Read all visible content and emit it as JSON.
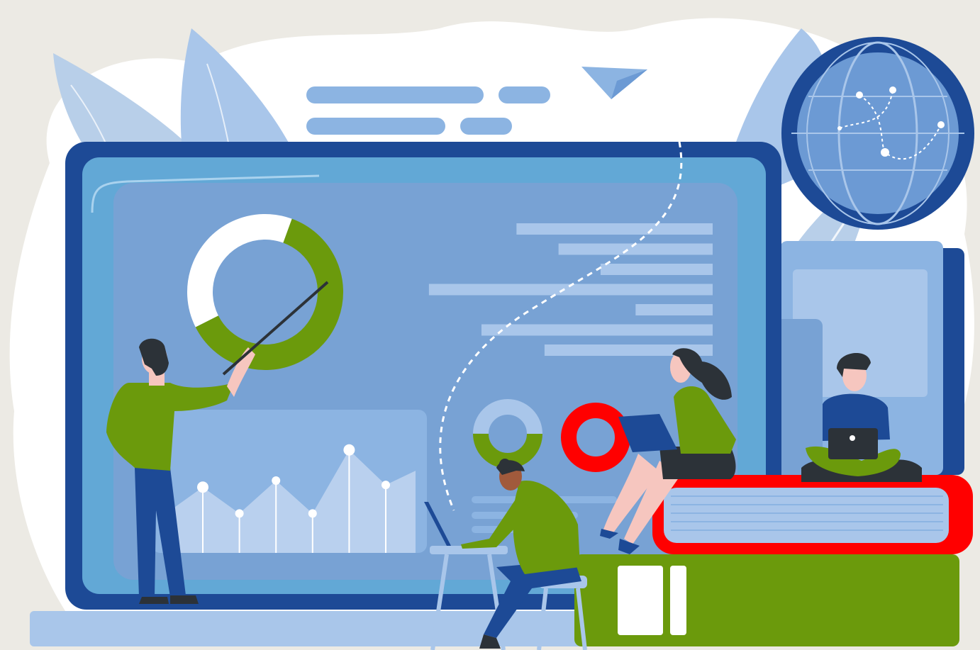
{
  "illustration": {
    "colors": {
      "background": "#eceae4",
      "blob": "#ffffff",
      "leaf": "#a9c6ea",
      "leaf_dark": "#8cb4e2",
      "monitor_frame": "#1d4a96",
      "monitor_screen": "#62a8d6",
      "panel": "#78a2d4",
      "bar_light": "#a9c6ea",
      "bar_dark": "#78a2d4",
      "accent_green": "#6b9a0c",
      "accent_red": "#ff0000",
      "skin": "#f6c6bf",
      "hair": "#2c3238",
      "navy": "#1d4a96",
      "white": "#ffffff"
    },
    "donut_chart": {
      "segments": [
        0.62,
        0.38
      ]
    },
    "red_ring": {
      "segments": [
        1.0
      ]
    },
    "small_ring": {
      "segments": [
        0.5,
        0.5
      ]
    },
    "line_chart": {
      "values": [
        3,
        1.8,
        3.3,
        1.8,
        4.7,
        3.1
      ]
    },
    "horizontal_bars": {
      "split": [
        0.44,
        0.56,
        0.68,
        0.19,
        0.78,
        0.34,
        0.52
      ]
    },
    "icons": [
      "paper-plane-icon",
      "globe-icon"
    ]
  }
}
